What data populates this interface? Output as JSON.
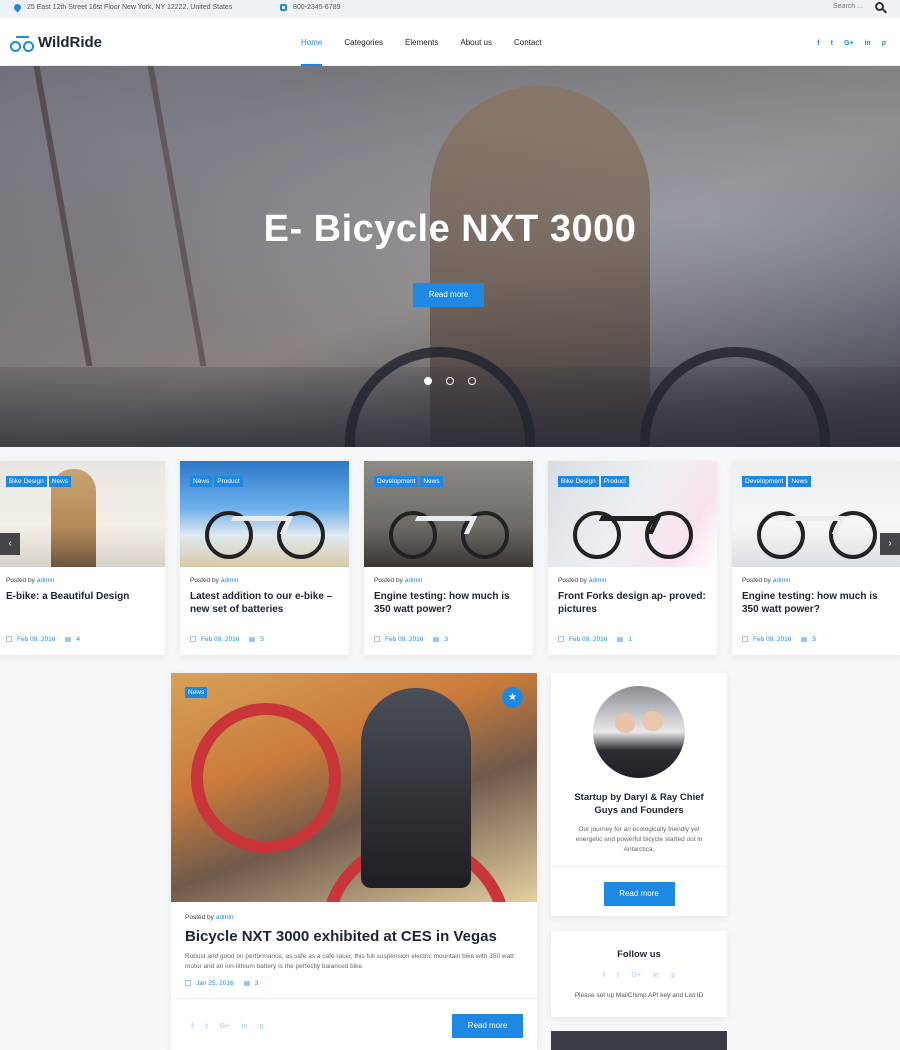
{
  "topbar": {
    "address": "25 East 12th Street 16st Floor New York, NY 12222, United States",
    "phone": "800-2345-6789",
    "search_placeholder": "Search ..."
  },
  "header": {
    "logo": "WildRide",
    "nav": [
      "Home",
      "Categories",
      "Elements",
      "About us",
      "Contact"
    ],
    "active_nav": "Home",
    "socials": [
      "f",
      "t",
      "G+",
      "in",
      "p"
    ]
  },
  "hero": {
    "title": "E- Bicycle NXT 3000",
    "button": "Read more",
    "slides": 3,
    "active_slide": 1
  },
  "cards": [
    {
      "tags": [
        "Bike Design",
        "News"
      ],
      "posted_by": "Posted by",
      "author": "admin",
      "title": "E-bike: a Beautiful Design",
      "date": "Feb 09, 2016",
      "comments": "4"
    },
    {
      "tags": [
        "News",
        "Product"
      ],
      "posted_by": "Posted by",
      "author": "admin",
      "title": "Latest addition to our e-bike – new set of batteries",
      "date": "Feb 09, 2016",
      "comments": "5"
    },
    {
      "tags": [
        "Development",
        "News"
      ],
      "posted_by": "Posted by",
      "author": "admin",
      "title": "Engine testing: how much is 350 watt power?",
      "date": "Feb 09, 2016",
      "comments": "3"
    },
    {
      "tags": [
        "Bike Design",
        "Product"
      ],
      "posted_by": "Posted by",
      "author": "admin",
      "title": "Front Forks design ap- proved: pictures",
      "date": "Feb 09, 2016",
      "comments": "1"
    },
    {
      "tags": [
        "Development",
        "News"
      ],
      "posted_by": "Posted by",
      "author": "admin",
      "title": "Engine testing: how much is 350 watt power?",
      "date": "Feb 09, 2016",
      "comments": "5"
    }
  ],
  "feature": {
    "tag": "News",
    "posted_by": "Posted by",
    "author": "admin",
    "title": "Bicycle NXT 3000 exhibited at CES in Vegas",
    "excerpt": "Robust and good on performance, as safe as a cafe racer, this full suspension electric mountain bike with 350 watt motor and an ion-lithium battery is the perfectly balanced bike.",
    "date": "Jan 25, 2016",
    "comments": "3",
    "button": "Read more",
    "share": [
      "f",
      "t",
      "G+",
      "in",
      "p"
    ]
  },
  "about": {
    "title": "Startup by Daryl & Ray Chief Guys and Founders",
    "text": "Our journey for an ecologically friendly yet energetic and powerful bicycle started out in Antarctica.",
    "button": "Read more"
  },
  "follow": {
    "title": "Follow us",
    "share": [
      "f",
      "t",
      "G+",
      "in",
      "p"
    ],
    "note": "Please set up MailChimp API key and List ID"
  },
  "icons": {
    "map_pin": "map-pin-icon",
    "phone": "phone-icon",
    "search": "search-icon",
    "calendar": "calendar-icon",
    "comment": "comment-icon",
    "star": "star-icon"
  },
  "colors": {
    "accent": "#1e88e5",
    "dark": "#1d2533"
  }
}
